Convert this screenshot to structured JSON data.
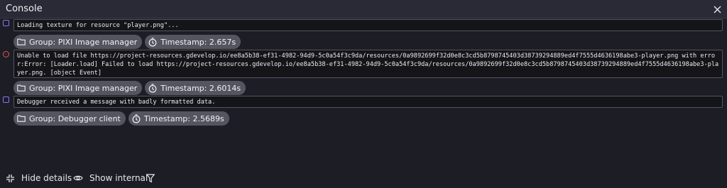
{
  "window": {
    "title": "Console"
  },
  "entries": [
    {
      "level": "info",
      "message": "Loading texture for resource \"player.png\"...",
      "group": "Group: PIXI Image manager",
      "timestamp": "Timestamp: 2.657s"
    },
    {
      "level": "error",
      "message": "Unable to load file https://project-resources.gdevelop.io/ee8a5b38-ef31-4982-94d9-5c0a54f3c9da/resources/0a9892699f32d0e8c3cd5b8798745403d38739294889ed4f7555d4636198abe3-player.png with error:Error: [Loader.load] Failed to load https://project-resources.gdevelop.io/ee8a5b38-ef31-4982-94d9-5c0a54f3c9da/resources/0a9892699f32d0e8c3cd5b8798745403d38739294889ed4f7555d4636198abe3-player.png. [object Event]",
      "group": "Group: PIXI Image manager",
      "timestamp": "Timestamp: 2.6014s"
    },
    {
      "level": "info",
      "message": "Debugger received a message with badly formatted data.",
      "group": "Group: Debugger client",
      "timestamp": "Timestamp: 2.5689s"
    }
  ],
  "footer": {
    "hide_details": "Hide details",
    "show_internal": "Show internal"
  },
  "icons": {
    "close": "close-icon",
    "info": "info-square-icon",
    "error": "error-circle-icon",
    "folder": "folder-icon",
    "timer": "stopwatch-icon",
    "collapse": "collapse-arrows-icon",
    "eye": "eye-icon",
    "filter": "filter-icon"
  },
  "colors": {
    "background": "#1d1d26",
    "info": "#7a7cf0",
    "error": "#e0584f",
    "chip": "#55555f"
  }
}
